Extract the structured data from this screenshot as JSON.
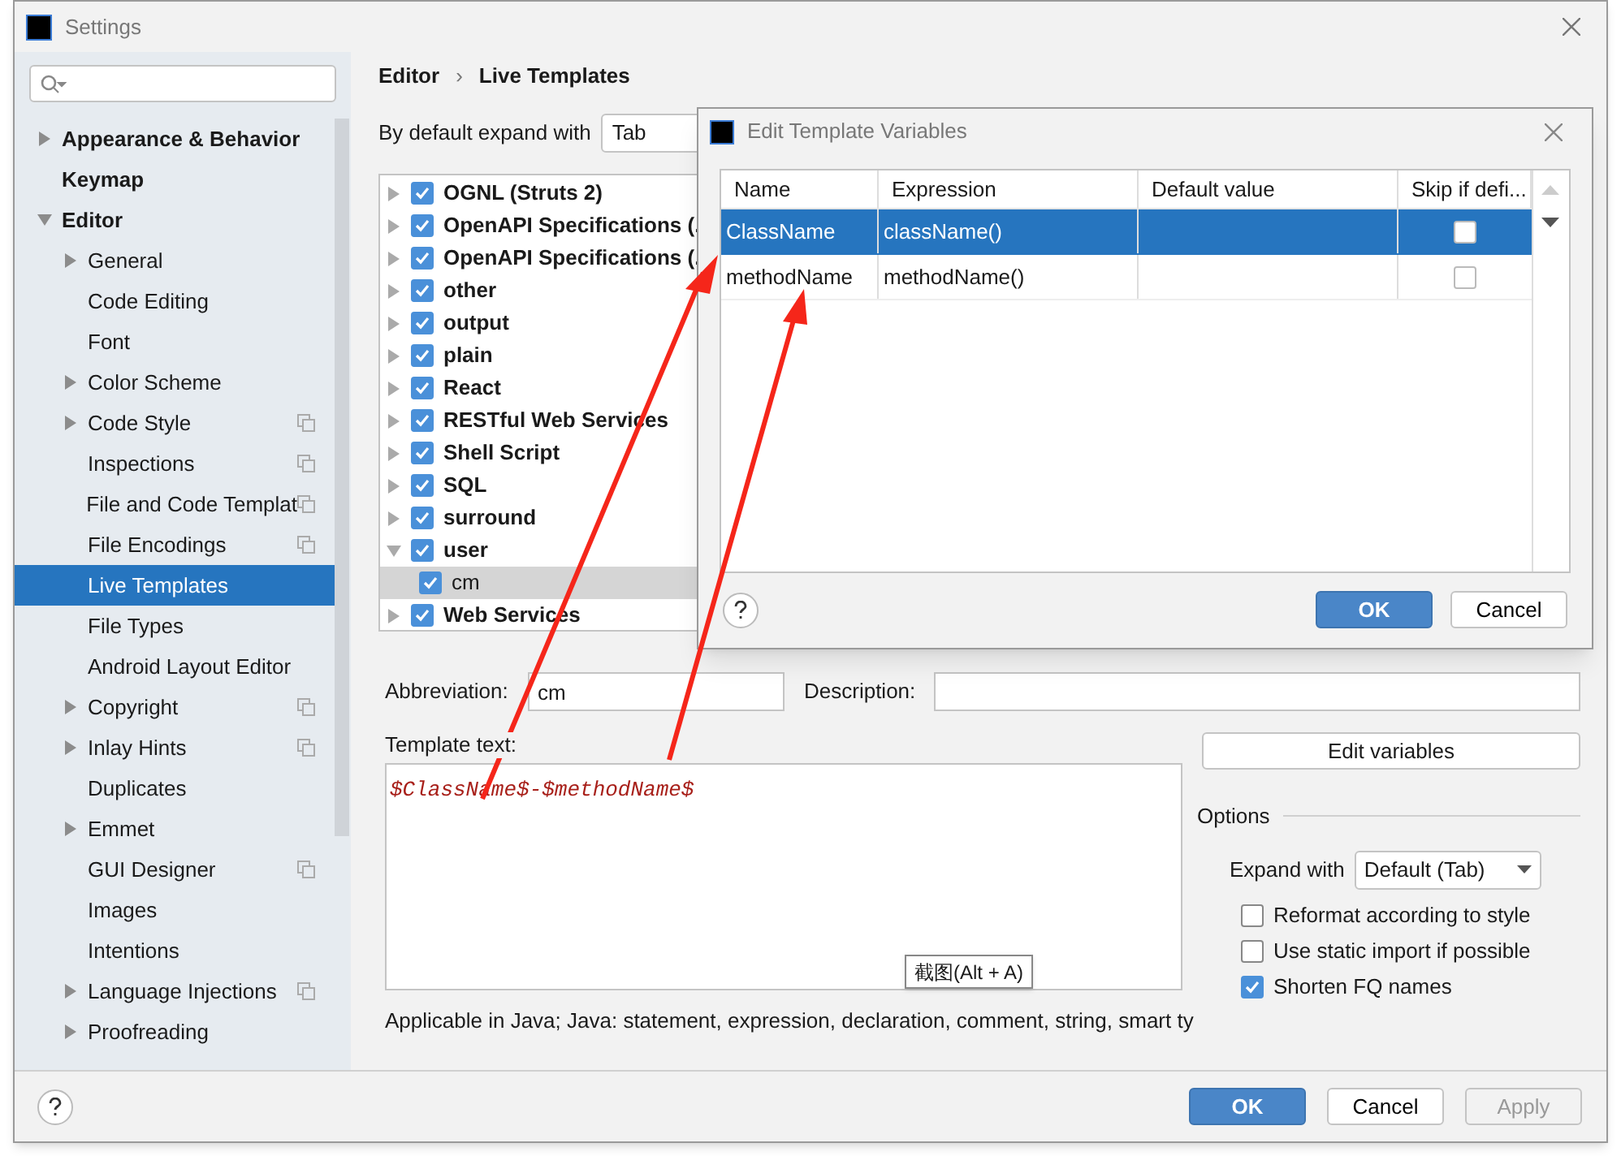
{
  "window": {
    "title": "Settings"
  },
  "sidebar": {
    "items": [
      {
        "label": "Appearance & Behavior",
        "expandable": true,
        "expanded": false,
        "selected": false,
        "shared": false
      },
      {
        "label": "Keymap",
        "expandable": false,
        "selected": false,
        "shared": false
      },
      {
        "label": "Editor",
        "expandable": true,
        "expanded": true,
        "selected": false,
        "shared": false,
        "children": [
          {
            "label": "General",
            "expandable": true,
            "selected": false,
            "shared": false
          },
          {
            "label": "Code Editing",
            "expandable": false,
            "selected": false,
            "shared": false
          },
          {
            "label": "Font",
            "expandable": false,
            "selected": false,
            "shared": false
          },
          {
            "label": "Color Scheme",
            "expandable": true,
            "selected": false,
            "shared": false
          },
          {
            "label": "Code Style",
            "expandable": true,
            "selected": false,
            "shared": true
          },
          {
            "label": "Inspections",
            "expandable": false,
            "selected": false,
            "shared": true
          },
          {
            "label": "File and Code Templat",
            "expandable": false,
            "selected": false,
            "shared": true
          },
          {
            "label": "File Encodings",
            "expandable": false,
            "selected": false,
            "shared": true
          },
          {
            "label": "Live Templates",
            "expandable": false,
            "selected": true,
            "shared": false
          },
          {
            "label": "File Types",
            "expandable": false,
            "selected": false,
            "shared": false
          },
          {
            "label": "Android Layout Editor",
            "expandable": false,
            "selected": false,
            "shared": false
          },
          {
            "label": "Copyright",
            "expandable": true,
            "selected": false,
            "shared": true
          },
          {
            "label": "Inlay Hints",
            "expandable": true,
            "selected": false,
            "shared": true
          },
          {
            "label": "Duplicates",
            "expandable": false,
            "selected": false,
            "shared": false
          },
          {
            "label": "Emmet",
            "expandable": true,
            "selected": false,
            "shared": false
          },
          {
            "label": "GUI Designer",
            "expandable": false,
            "selected": false,
            "shared": true
          },
          {
            "label": "Images",
            "expandable": false,
            "selected": false,
            "shared": false
          },
          {
            "label": "Intentions",
            "expandable": false,
            "selected": false,
            "shared": false
          },
          {
            "label": "Language Injections",
            "expandable": true,
            "selected": false,
            "shared": true
          },
          {
            "label": "Proofreading",
            "expandable": true,
            "selected": false,
            "shared": false
          }
        ]
      }
    ]
  },
  "breadcrumb": {
    "parts": [
      "Editor",
      "Live Templates"
    ],
    "separator": "›"
  },
  "expand_default": {
    "label": "By default expand with",
    "value": "Tab"
  },
  "template_groups": [
    {
      "label": "OGNL (Struts 2)",
      "checked": true,
      "expanded": false,
      "selected": false
    },
    {
      "label": "OpenAPI Specifications (.",
      "checked": true,
      "expanded": false,
      "selected": false
    },
    {
      "label": "OpenAPI Specifications (.",
      "checked": true,
      "expanded": false,
      "selected": false
    },
    {
      "label": "other",
      "checked": true,
      "expanded": false,
      "selected": false
    },
    {
      "label": "output",
      "checked": true,
      "expanded": false,
      "selected": false
    },
    {
      "label": "plain",
      "checked": true,
      "expanded": false,
      "selected": false
    },
    {
      "label": "React",
      "checked": true,
      "expanded": false,
      "selected": false
    },
    {
      "label": "RESTful Web Services",
      "checked": true,
      "expanded": false,
      "selected": false
    },
    {
      "label": "Shell Script",
      "checked": true,
      "expanded": false,
      "selected": false
    },
    {
      "label": "SQL",
      "checked": true,
      "expanded": false,
      "selected": false
    },
    {
      "label": "surround",
      "checked": true,
      "expanded": false,
      "selected": false
    },
    {
      "label": "user",
      "checked": true,
      "expanded": true,
      "selected": false,
      "children": [
        {
          "label": "cm",
          "checked": true,
          "selected": true
        }
      ]
    },
    {
      "label": "Web Services",
      "checked": true,
      "expanded": false,
      "selected": false
    }
  ],
  "abbreviation": {
    "label": "Abbreviation:",
    "value": "cm"
  },
  "description": {
    "label": "Description:"
  },
  "template_text": {
    "label": "Template text:",
    "value": "$ClassName$-$methodName$"
  },
  "applicable": "Applicable in Java; Java: statement, expression, declaration, comment, string, smart ty",
  "edit_variables_button": "Edit variables",
  "options": {
    "title": "Options",
    "expand_with": {
      "label": "Expand with",
      "value": "Default (Tab)"
    },
    "checkboxes": [
      {
        "label": "Reformat according to style",
        "checked": false
      },
      {
        "label": "Use static import if possible",
        "checked": false
      },
      {
        "label": "Shorten FQ names",
        "checked": true
      }
    ]
  },
  "tooltip": "截图(Alt + A)",
  "footer": {
    "buttons": [
      {
        "label": "OK",
        "kind": "primary"
      },
      {
        "label": "Cancel",
        "kind": "normal"
      },
      {
        "label": "Apply",
        "kind": "disabled"
      }
    ]
  },
  "variables_dialog": {
    "title": "Edit Template Variables",
    "columns": [
      "Name",
      "Expression",
      "Default value",
      "Skip if defi..."
    ],
    "rows": [
      {
        "name": "ClassName",
        "expression": "className()",
        "skip": false,
        "selected": true
      },
      {
        "name": "methodName",
        "expression": "methodName()",
        "skip": false,
        "selected": false
      }
    ],
    "buttons": [
      {
        "label": "OK",
        "kind": "primary"
      },
      {
        "label": "Cancel",
        "kind": "normal"
      }
    ]
  }
}
